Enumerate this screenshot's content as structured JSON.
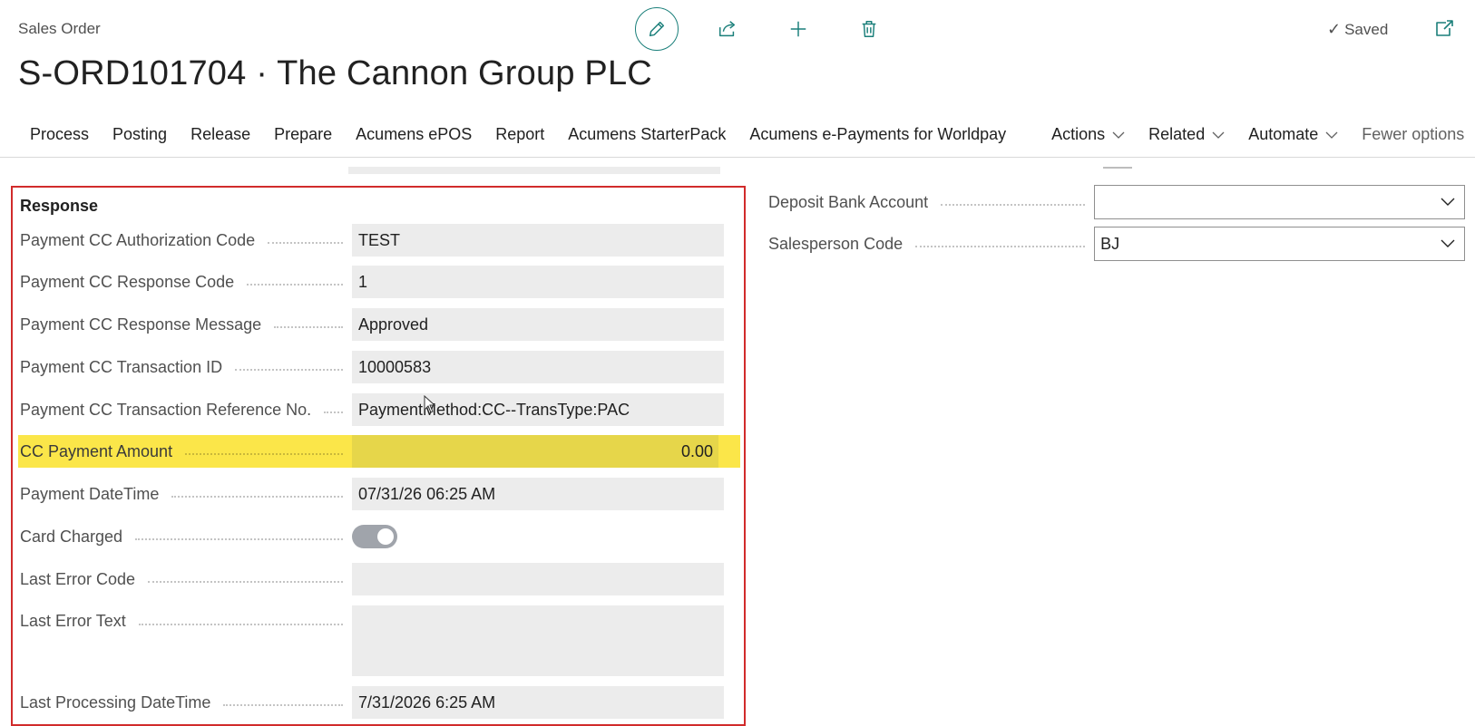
{
  "header": {
    "caption": "Sales Order",
    "title": "S-ORD101704 · The Cannon Group PLC",
    "saved_label": "Saved"
  },
  "toolbar": {
    "icons": [
      "edit-pencil-icon",
      "share-icon",
      "add-icon",
      "delete-icon"
    ],
    "accent_color": "#1a7f7a"
  },
  "action_bar": {
    "items": [
      "Process",
      "Posting",
      "Release",
      "Prepare",
      "Acumens ePOS",
      "Report",
      "Acumens StarterPack",
      "Acumens e-Payments for Worldpay"
    ],
    "menus": [
      "Actions",
      "Related",
      "Automate"
    ],
    "fewer_options": "Fewer options"
  },
  "response": {
    "section_title": "Response",
    "fields": {
      "auth_code": {
        "label": "Payment CC Authorization Code",
        "value": "TEST"
      },
      "response_code": {
        "label": "Payment CC Response Code",
        "value": "1"
      },
      "response_message": {
        "label": "Payment CC Response Message",
        "value": "Approved"
      },
      "transaction_id": {
        "label": "Payment CC Transaction ID",
        "value": "10000583"
      },
      "transaction_ref": {
        "label": "Payment CC Transaction Reference No.",
        "value": "PaymentMethod:CC--TransType:PAC"
      },
      "cc_amount": {
        "label": "CC Payment Amount",
        "value": "0.00"
      },
      "payment_datetime": {
        "label": "Payment DateTime",
        "value": "07/31/26 06:25 AM"
      },
      "card_charged": {
        "label": "Card Charged",
        "value": true
      },
      "last_error_code": {
        "label": "Last Error Code",
        "value": ""
      },
      "last_error_text": {
        "label": "Last Error Text",
        "value": ""
      },
      "last_processing": {
        "label": "Last Processing DateTime",
        "value": "7/31/2026 6:25 AM"
      }
    },
    "highlight_color": "#fbe649",
    "border_color": "#d12b2b"
  },
  "right_fields": {
    "deposit_bank": {
      "label": "Deposit Bank Account",
      "value": ""
    },
    "salesperson": {
      "label": "Salesperson Code",
      "value": "BJ"
    }
  }
}
